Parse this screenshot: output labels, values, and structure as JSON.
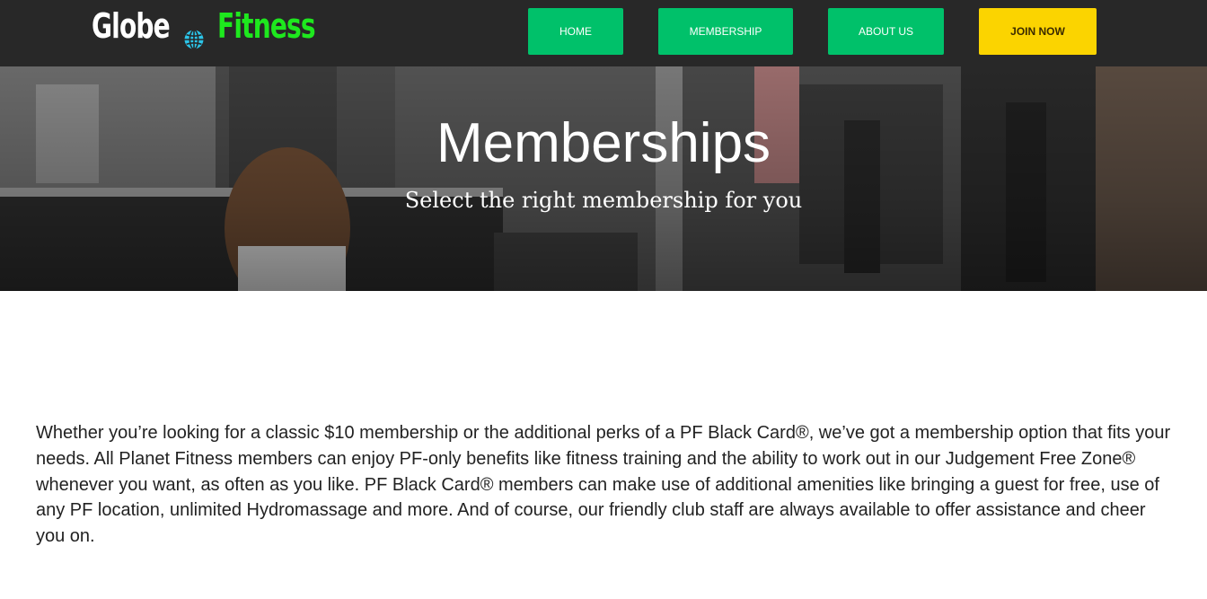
{
  "header": {
    "logo_part1": "Globe",
    "logo_part2": "Fitness",
    "logo_icon": "globe-icon",
    "nav": {
      "home": "HOME",
      "membership": "MEMBERSHIP",
      "about": "ABOUT US",
      "join": "JOIN NOW"
    }
  },
  "hero": {
    "title": "Memberships",
    "subtitle": "Select the right membership for you"
  },
  "intro": {
    "text": "Whether you’re looking for a classic $10 membership or the additional perks of a PF Black Card®, we’ve got a membership option that fits your needs. All Planet Fitness members can enjoy PF-only benefits like fitness training and the ability to work out in our Judgement Free Zone® whenever you want, as often as you like. PF Black Card® members can make use of additional amenities like bringing a guest for free, use of any PF location, unlimited Hydromassage and more. And of course, our friendly club staff are always available to offer assistance and cheer you on."
  },
  "colors": {
    "topbar": "#282828",
    "nav_green": "#00c16a",
    "join_yellow": "#fbd400",
    "logo_green": "#1ee81e",
    "globe_cyan": "#2bc4e8"
  }
}
